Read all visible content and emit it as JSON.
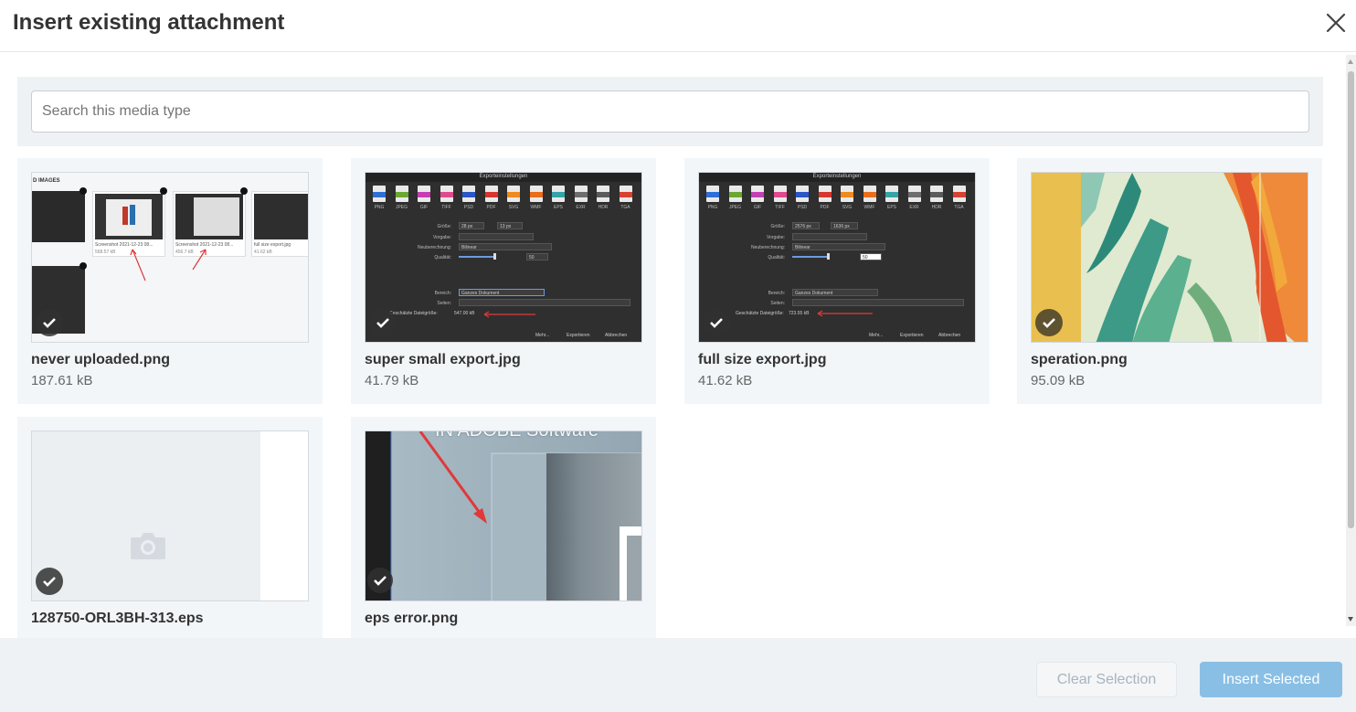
{
  "dialog": {
    "title": "Insert existing attachment",
    "close_icon": "close-icon"
  },
  "search": {
    "placeholder": "Search this media type",
    "value": ""
  },
  "attachments": [
    {
      "name": "never uploaded.png",
      "size": "187.61 kB",
      "selected": true
    },
    {
      "name": "super small export.jpg",
      "size": "41.79 kB",
      "selected": true
    },
    {
      "name": "full size export.jpg",
      "size": "41.62 kB",
      "selected": true
    },
    {
      "name": "speration.png",
      "size": "95.09 kB",
      "selected": true
    },
    {
      "name": "128750-ORL3BH-313.eps",
      "size": "",
      "selected": true
    },
    {
      "name": "eps error.png",
      "size": "",
      "selected": true
    }
  ],
  "thumb_text": {
    "dialog_title": "Exporteinstellungen",
    "formats": [
      "PNG",
      "JPEG",
      "GIF",
      "TIFF",
      "PSD",
      "PDF",
      "SVG",
      "WMF",
      "EPS",
      "EXR",
      "HDR",
      "TGA"
    ],
    "format_colors": [
      "#2d6fd6",
      "#6aa832",
      "#c43fb3",
      "#e04a8d",
      "#2b56c8",
      "#d6362d",
      "#ef8a1c",
      "#ea6d1b",
      "#35a4a8",
      "#6e6e6e",
      "#5b5b5b",
      "#d94130"
    ],
    "labels": {
      "size": "Größe:",
      "preset": "Vorgabe:",
      "resample": "Neuberechnung:",
      "quality": "Qualität:",
      "area": "Bereich:",
      "pages": "Seiten:",
      "estimate": "Geschätzte Dateigröße:"
    },
    "resample_value": "Bilinear",
    "area_value": "Ganzes Dokument",
    "footer": [
      "Mehr...",
      "Exportieren",
      "Abbrechen"
    ],
    "small": {
      "w": "28 px",
      "h": "13 px",
      "quality": "50",
      "estimate": "547.00 kB"
    },
    "full": {
      "w": "2576 px",
      "h": "1636 px",
      "quality": "50",
      "estimate": "723.55 kB"
    },
    "adobe_text": "IN ADOBE Software",
    "mini_files": [
      {
        "name": "Screenshot 2021-12-23 08...",
        "size": "568.57 kB"
      },
      {
        "name": "Screenshot 2021-12-23 08...",
        "size": "456.7 kB"
      },
      {
        "name": "full size export.jpg",
        "size": "41.62 kB"
      }
    ],
    "images_label": "D IMAGES"
  },
  "footer": {
    "clear_label": "Clear Selection",
    "insert_label": "Insert Selected"
  },
  "colors": {
    "primary_disabled": "#8abfe5",
    "panel_bg": "#eef2f5",
    "card_bg": "#f3f6f9"
  }
}
